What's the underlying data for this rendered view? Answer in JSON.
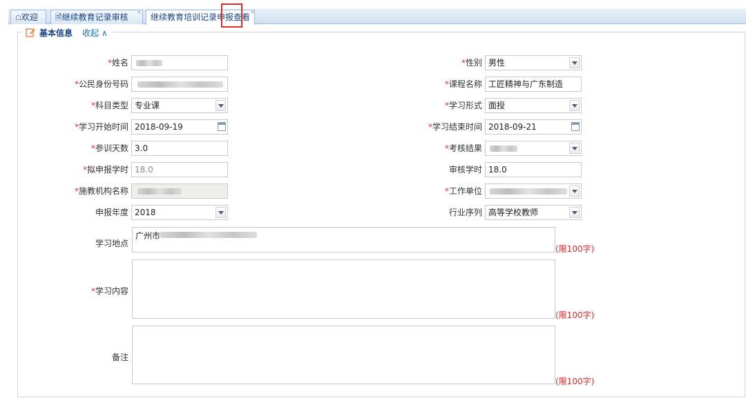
{
  "tabs": [
    {
      "label": "欢迎",
      "icon": "home-icon"
    },
    {
      "label": "继续教育记录审核",
      "icon": "document-icon",
      "close": "×"
    },
    {
      "label": "继续教育培训记录申报查看",
      "close": "×"
    }
  ],
  "section": {
    "title": "基本信息",
    "collapse": "收起",
    "collapse_glyph": "∧"
  },
  "req": "*",
  "fields": {
    "name": {
      "label": "姓名",
      "value": ""
    },
    "gender": {
      "label": "性别",
      "value": "男性"
    },
    "id_number": {
      "label": "公民身份号码",
      "value": ""
    },
    "course_name": {
      "label": "课程名称",
      "value": "工匠精神与广东制造"
    },
    "subject_type": {
      "label": "科目类型",
      "value": "专业课"
    },
    "study_form": {
      "label": "学习形式",
      "value": "面授"
    },
    "start_date": {
      "label": "学习开始时间",
      "value": "2018-09-19"
    },
    "end_date": {
      "label": "学习结束时间",
      "value": "2018-09-21"
    },
    "days": {
      "label": "参训天数",
      "value": "3.0"
    },
    "result": {
      "label": "考核结果",
      "value": ""
    },
    "declared_hours": {
      "label": "拟申报学时",
      "value": "18.0"
    },
    "approved_hours": {
      "label": "审核学时",
      "value": "18.0"
    },
    "institution": {
      "label": "施教机构名称",
      "value": ""
    },
    "employer": {
      "label": "工作单位",
      "value": ""
    },
    "year": {
      "label": "申报年度",
      "value": "2018"
    },
    "industry": {
      "label": "行业序列",
      "value": "高等学校教师"
    },
    "location": {
      "label": "学习地点",
      "value": "广州市"
    },
    "content": {
      "label": "学习内容",
      "value": ""
    },
    "remark": {
      "label": "备注",
      "value": ""
    }
  },
  "limit_note": "(限100字)"
}
